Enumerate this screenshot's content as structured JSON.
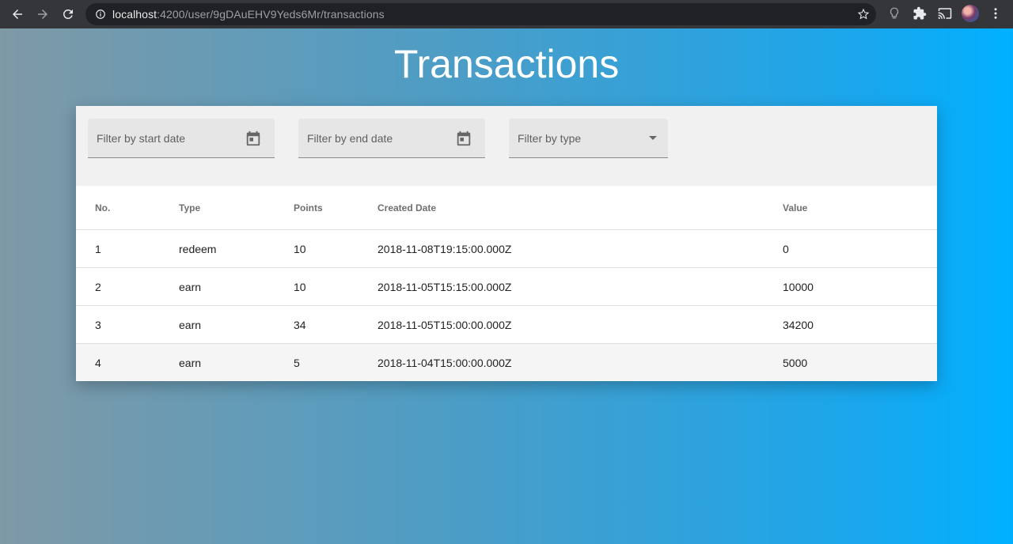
{
  "browser": {
    "url_host": "localhost",
    "url_rest": ":4200/user/9gDAuEHV9Yeds6Mr/transactions"
  },
  "page": {
    "title": "Transactions"
  },
  "filters": {
    "start_date_placeholder": "Filter by start date",
    "end_date_placeholder": "Filter by end date",
    "type_placeholder": "Filter by type"
  },
  "table": {
    "headers": [
      "No.",
      "Type",
      "Points",
      "Created Date",
      "Value"
    ],
    "rows": [
      [
        "1",
        "redeem",
        "10",
        "2018-11-08T19:15:00.000Z",
        "0"
      ],
      [
        "2",
        "earn",
        "10",
        "2018-11-05T15:15:00.000Z",
        "10000"
      ],
      [
        "3",
        "earn",
        "34",
        "2018-11-05T15:00:00.000Z",
        "34200"
      ],
      [
        "4",
        "earn",
        "5",
        "2018-11-04T15:00:00.000Z",
        "5000"
      ]
    ]
  },
  "icons": {
    "back": "arrow-left-icon",
    "forward": "arrow-right-icon",
    "reload": "reload-icon",
    "info": "info-icon",
    "bookmark": "star-icon",
    "extension1": "lightbulb-icon",
    "extension2": "puzzle-icon",
    "cast": "cast-icon",
    "menu": "more-vert-icon",
    "calendar": "calendar-icon",
    "dropdown": "dropdown-arrow-icon"
  },
  "colors": {
    "gradient_start": "#7f99a6",
    "gradient_end": "#00b0ff",
    "title_color": "#ffffff"
  }
}
